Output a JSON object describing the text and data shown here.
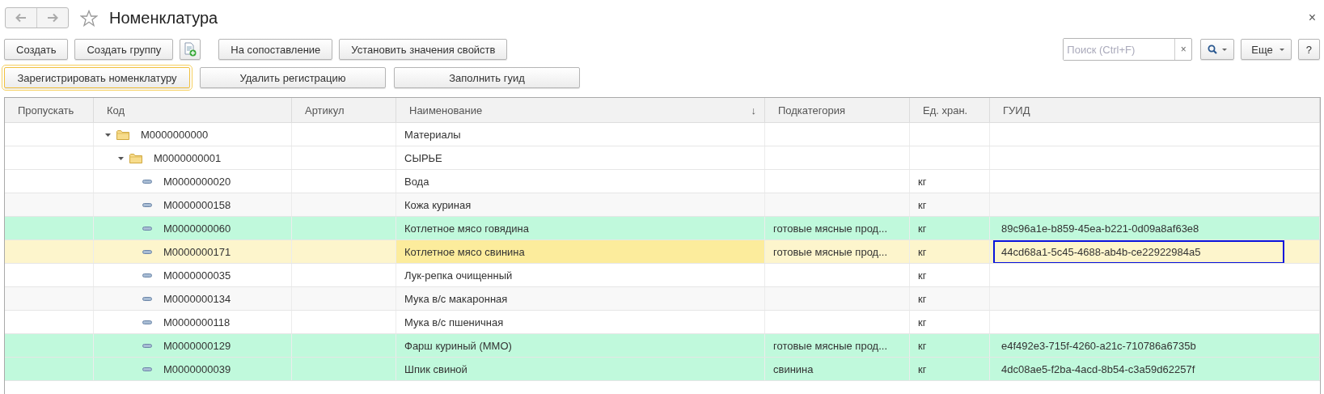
{
  "window": {
    "title": "Номенклатура",
    "close": "×"
  },
  "toolbar": [
    {
      "kind": "text",
      "label": "Создать"
    },
    {
      "kind": "text",
      "label": "Создать группу"
    },
    {
      "kind": "icon"
    },
    {
      "kind": "text",
      "label": "На сопоставление"
    },
    {
      "kind": "text",
      "label": "Установить значения свойств"
    }
  ],
  "search": {
    "placeholder": "Поиск (Ctrl+F)",
    "clear": "×"
  },
  "toolbar_right": [
    {
      "kind": "search"
    },
    {
      "kind": "more",
      "label": "Еще"
    },
    {
      "kind": "help",
      "label": "?"
    }
  ],
  "actions": [
    {
      "label": "Зарегистрировать номенклатуру",
      "default": true
    },
    {
      "label": "Удалить регистрацию",
      "default": false
    },
    {
      "label": "Заполнить гуид",
      "default": false
    }
  ],
  "table": {
    "columns": [
      {
        "title": "Пропускать"
      },
      {
        "title": "Код"
      },
      {
        "title": "Артикул"
      },
      {
        "title": "Наименование",
        "sort_mark": "↓"
      },
      {
        "title": "Подкатегория"
      },
      {
        "title": "Ед. хран."
      },
      {
        "title": "ГУИД"
      }
    ],
    "rows": [
      {
        "kind": "group",
        "expanded": true,
        "selected": false,
        "code": "M0000000000",
        "name": "Материалы",
        "children": [
          {
            "kind": "group",
            "expanded": true,
            "selected": false,
            "code": "M0000000001",
            "name": "СЫРЬЕ",
            "children": [
              {
                "kind": "item",
                "selected": false,
                "code": "M0000000020",
                "name": "Вода",
                "unit": "кг"
              },
              {
                "kind": "item",
                "selected": false,
                "code": "M0000000158",
                "name": "Кожа куриная",
                "unit": "кг"
              },
              {
                "kind": "item",
                "selected": false,
                "code": "M0000000060",
                "name": "Котлетное мясо говядина",
                "subcategory": "готовые мясные прод...",
                "unit": "кг",
                "guid": "89c96a1e-b859-45ea-b221-0d09a8af63e8",
                "color": "#c0f9dc"
              },
              {
                "kind": "item",
                "selected": true,
                "guid_focused": true,
                "code": "M0000000171",
                "name": "Котлетное мясо свинина",
                "subcategory": "готовые мясные прод...",
                "unit": "кг",
                "guid": "44cd68a1-5c45-4688-ab4b-ce22922984a5"
              },
              {
                "kind": "item",
                "selected": false,
                "code": "M0000000035",
                "name": "Лук-репка очищенный",
                "unit": "кг"
              },
              {
                "kind": "item",
                "selected": false,
                "code": "M0000000134",
                "name": "Мука в/с макаронная",
                "unit": "кг"
              },
              {
                "kind": "item",
                "selected": false,
                "code": "M0000000118",
                "name": "Мука в/с пшеничная",
                "unit": "кг"
              },
              {
                "kind": "item",
                "selected": false,
                "code": "M0000000129",
                "name": "Фарш куриный (ММО)",
                "subcategory": "готовые мясные прод...",
                "unit": "кг",
                "guid": "e4f492e3-715f-4260-a21c-710786a6735b",
                "color": "#c0f9dc"
              },
              {
                "kind": "item",
                "selected": false,
                "code": "M0000000039",
                "name": "Шпик свиной",
                "subcategory": "свинина",
                "unit": "кг",
                "guid": "4dc08ae5-f2ba-4acd-8b54-c3a59d62257f",
                "color": "#c0f9dc"
              }
            ]
          }
        ]
      }
    ]
  }
}
